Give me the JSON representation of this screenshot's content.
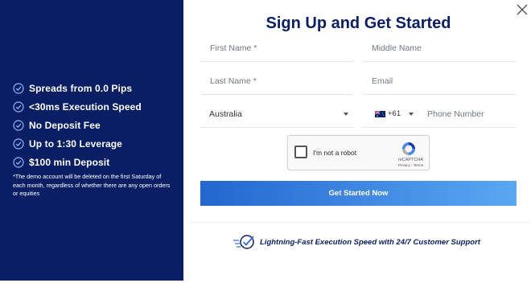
{
  "left": {
    "features": [
      {
        "label": "Spreads from 0.0 Pips"
      },
      {
        "label": "<30ms Execution Speed"
      },
      {
        "label": "No Deposit Fee"
      },
      {
        "label": "Up to 1:30 Leverage"
      },
      {
        "label": "$100 min Deposit"
      }
    ],
    "disclaimer": "*The demo account will be deleted on the first Saturday of each month, regardless of whether there are any open orders or equities"
  },
  "form": {
    "title": "Sign Up and Get Started",
    "first_name_placeholder": "First Name *",
    "middle_name_placeholder": "Middle Name",
    "last_name_placeholder": "Last Name *",
    "email_placeholder": "Email",
    "country_value": "Australia",
    "dial_code": "+61",
    "phone_placeholder": "Phone Number",
    "captcha_label": "I'm not a robot",
    "captcha_brand": "reCAPTCHA",
    "captcha_links": "Privacy - Terms",
    "submit_label": "Get Started Now",
    "tagline": "Lightning-Fast Execution Speed with 24/7 Customer Support"
  },
  "colors": {
    "brand_navy": "#0a1f63",
    "button_gradient_start": "#2366cf",
    "button_gradient_end": "#5aa7f3"
  },
  "icons": {
    "close": "close-icon",
    "check": "check-circle-icon",
    "caret": "caret-down-icon",
    "flag": "australia-flag-icon",
    "captcha": "recaptcha-logo-icon",
    "speed": "speed-check-icon"
  }
}
